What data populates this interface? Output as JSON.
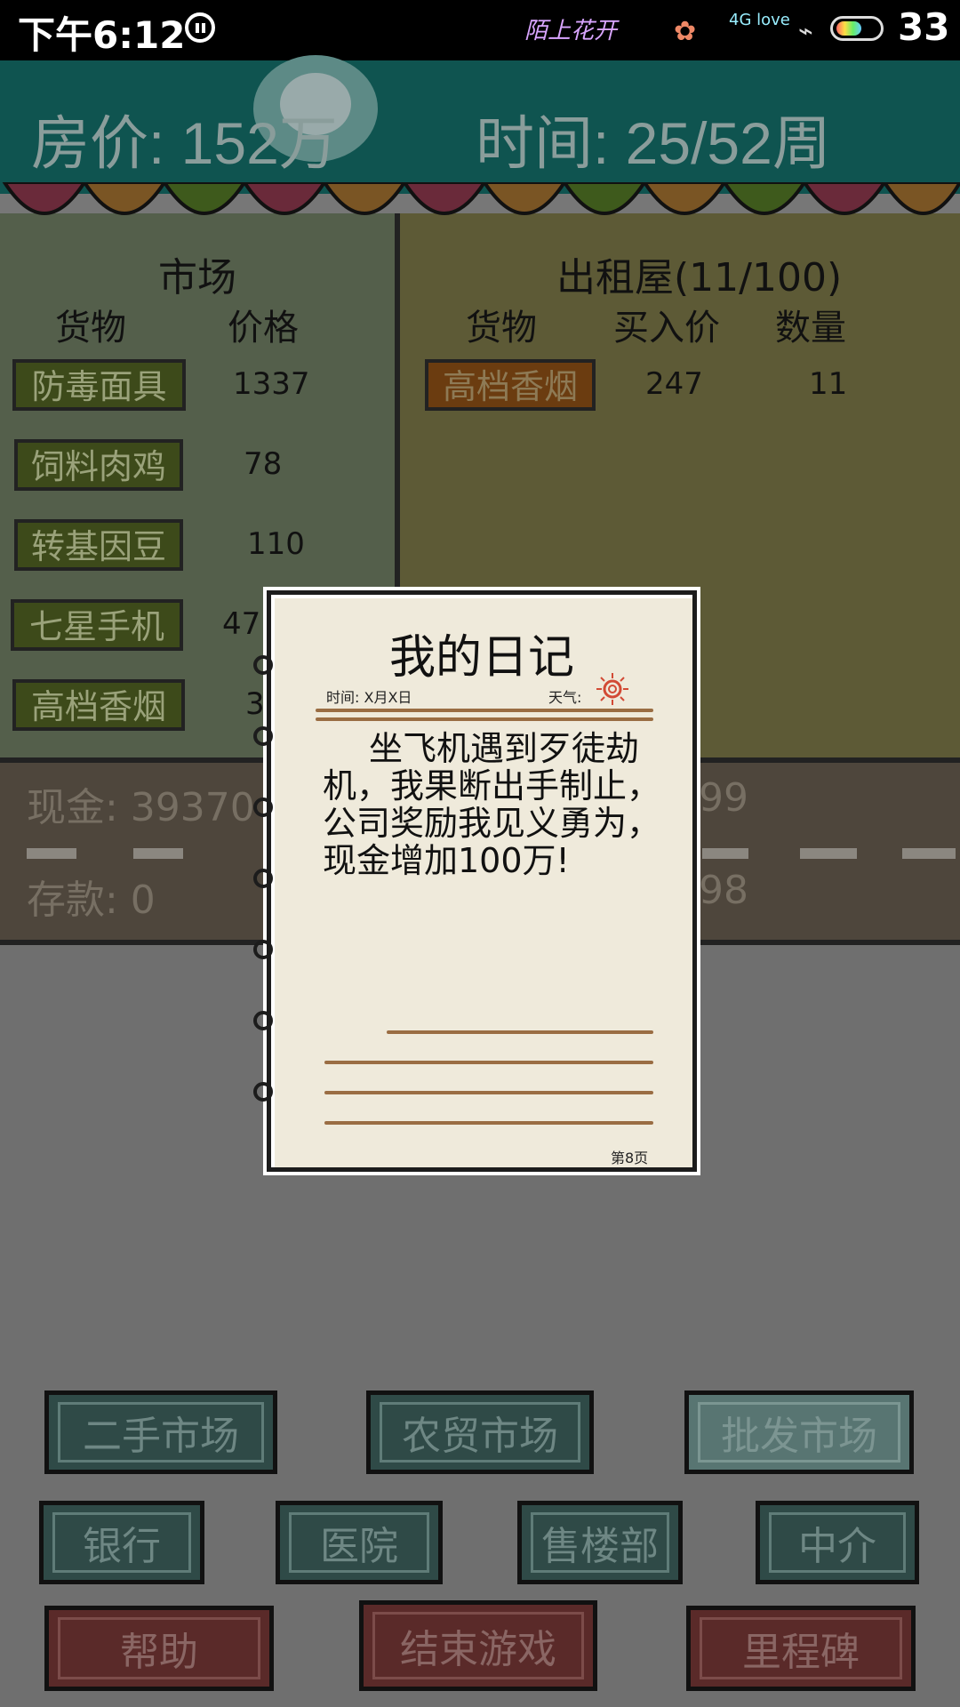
{
  "status_bar": {
    "time": "下午6:12",
    "carrier_art": "陌上花开",
    "network": "4G love",
    "battery_level": "33"
  },
  "header": {
    "price_label": "房价: 152万",
    "weeks_label": "时间: 25/52周"
  },
  "market": {
    "title": "市场",
    "col_goods": "货物",
    "col_price": "价格",
    "items": [
      {
        "name": "防毒面具",
        "price": "1337"
      },
      {
        "name": "饲料肉鸡",
        "price": "78"
      },
      {
        "name": "转基因豆",
        "price": "110"
      },
      {
        "name": "七星手机",
        "price": "47"
      },
      {
        "name": "高档香烟",
        "price": "3"
      }
    ]
  },
  "rental": {
    "title": "出租屋(11/100)",
    "col_goods": "货物",
    "col_buy": "买入价",
    "col_qty": "数量",
    "items": [
      {
        "name": "高档香烟",
        "buy_price": "247",
        "qty": "11"
      }
    ]
  },
  "finance": {
    "cash": "现金: 39370",
    "deposit": "存款: 0",
    "right_top": "99",
    "right_bottom": "98"
  },
  "diary": {
    "title": "我的日记",
    "time": "时间: X月X日",
    "weather": "天气:",
    "body": "坐飞机遇到歹徒劫机，我果断出手制止，公司奖励我见义勇为，现金增加100万!",
    "page": "第8页"
  },
  "buttons": {
    "second_hand": "二手市场",
    "farm": "农贸市场",
    "wholesale": "批发市场",
    "bank": "银行",
    "hospital": "医院",
    "sales": "售楼部",
    "agent": "中介",
    "help": "帮助",
    "end_game": "结束游戏",
    "milestone": "里程碑"
  },
  "colors": {
    "header": "#0f5450",
    "market_panel": "#545f4b",
    "rental_panel": "#5d5a36",
    "diary_paper": "#efeadb"
  }
}
